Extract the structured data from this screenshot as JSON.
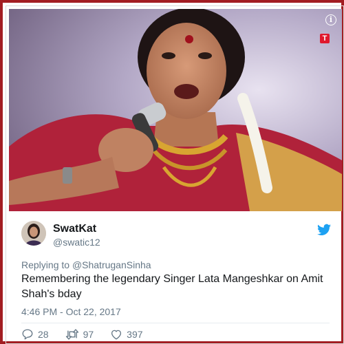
{
  "colors": {
    "frame_border": "#a21d22",
    "text_primary": "#14171a",
    "text_secondary": "#657786",
    "twitter_blue": "#1da1f2",
    "heart_outline": "#657786"
  },
  "media": {
    "info_icon_label": "i",
    "brand_icon_label": "T"
  },
  "tweet": {
    "display_name": "SwatKat",
    "handle": "@swatic12",
    "replying_prefix": "Replying to ",
    "replying_to": "@ShatruganSinha",
    "text": "Remembering the legendary Singer Lata Mangeshkar on Amit Shah's bday",
    "timestamp": "4:46 PM - Oct 22, 2017",
    "stats": {
      "replies": "28",
      "retweets": "97",
      "likes": "397"
    }
  }
}
